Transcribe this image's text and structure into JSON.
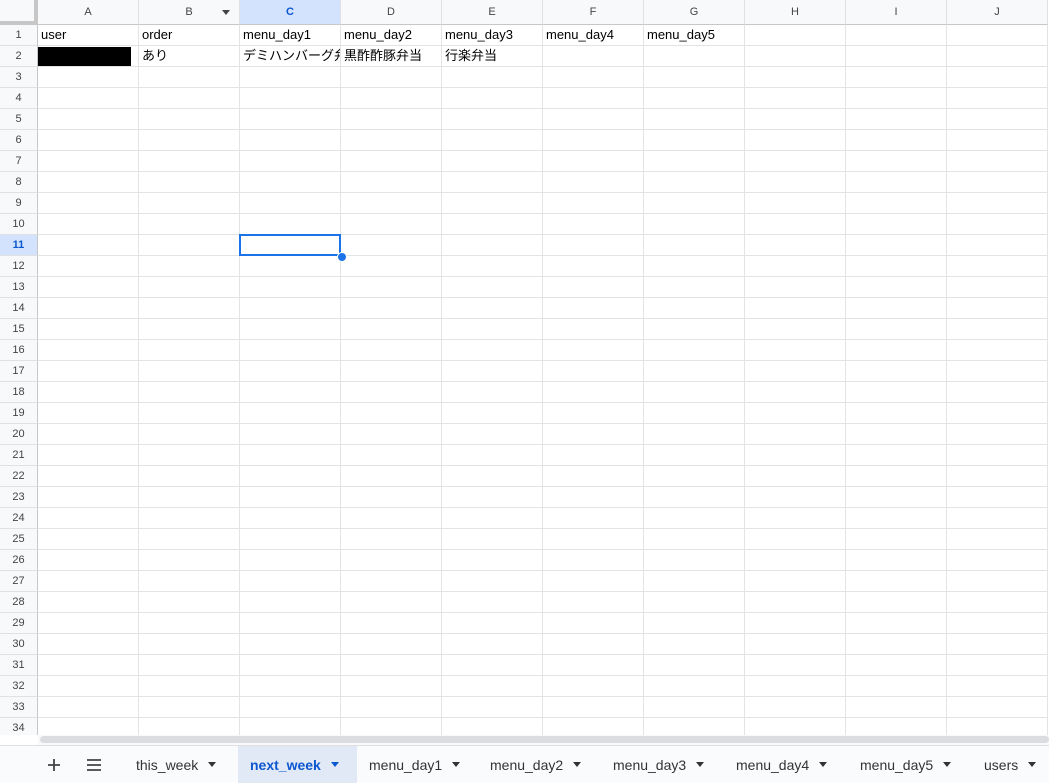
{
  "sheet": {
    "columns": [
      "A",
      "B",
      "C",
      "D",
      "E",
      "F",
      "G",
      "H",
      "I",
      "J"
    ],
    "selected_column": "C",
    "selected_row": "11",
    "rows": [
      "1",
      "2",
      "3",
      "4",
      "5",
      "6",
      "7",
      "8",
      "9",
      "10",
      "11",
      "12",
      "13",
      "14",
      "15",
      "16",
      "17",
      "18",
      "19",
      "20",
      "21",
      "22",
      "23",
      "24",
      "25",
      "26",
      "27",
      "28",
      "29",
      "30",
      "31",
      "32",
      "33",
      "34"
    ],
    "cells": {
      "row1": [
        "user",
        "order",
        "menu_day1",
        "menu_day2",
        "menu_day3",
        "menu_day4",
        "menu_day5",
        "",
        "",
        ""
      ],
      "row2": [
        "",
        "あり",
        "デミハンバーグ弁",
        "黒酢酢豚弁当",
        "行楽弁当",
        "",
        "",
        "",
        "",
        ""
      ]
    }
  },
  "sheet_bar": {
    "add_icon": "plus-icon",
    "menu_icon": "hamburger-menu-icon",
    "tabs": [
      "this_week",
      "next_week",
      "menu_day1",
      "menu_day2",
      "menu_day3",
      "menu_day4",
      "menu_day5",
      "users"
    ],
    "active_tab": "next_week"
  },
  "colors": {
    "accent": "#1a73e8",
    "header_selected": "#d3e3fd",
    "tab_active": "#e1e9f7"
  }
}
